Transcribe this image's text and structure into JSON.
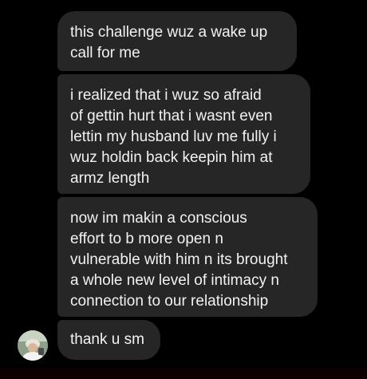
{
  "conversation": {
    "messages": [
      {
        "lines": [
          "this challenge wuz a wake up",
          "call for me"
        ]
      },
      {
        "lines": [
          "i realized that i wuz so afraid",
          "of gettin hurt that i wasnt even",
          "lettin my husband luv me fully i",
          "wuz holdin back keepin him at",
          "armz length"
        ]
      },
      {
        "lines": [
          "now im makin a conscious",
          "effort to b more open n",
          "vulnerable with him n its brought",
          "a whole new level of intimacy n",
          "connection to our relationship"
        ]
      },
      {
        "lines": [
          "thank u sm"
        ]
      }
    ],
    "sender_avatar_icon": "profile-photo-avatar"
  },
  "colors": {
    "background": "#000000",
    "bubble": "#262626",
    "text": "#f2f2f2"
  }
}
